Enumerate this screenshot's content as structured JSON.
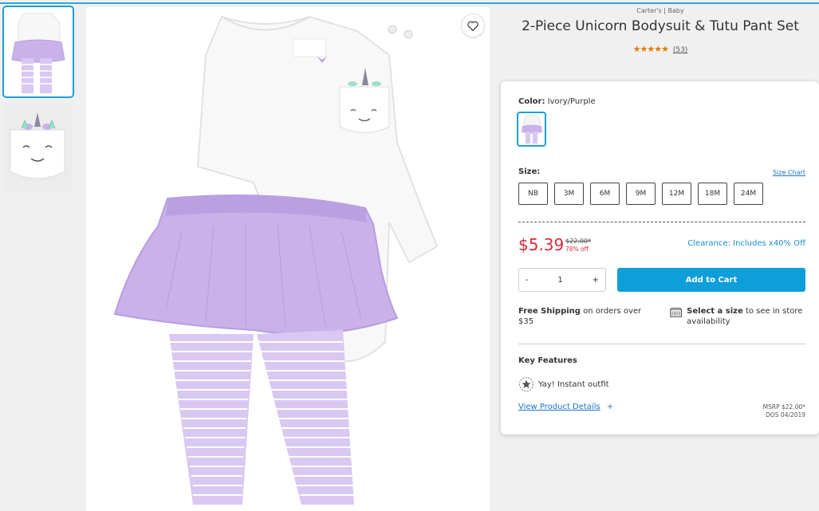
{
  "brand": "Carter's | Baby",
  "product_title": "2-Piece Unicorn Bodysuit & Tutu Pant Set",
  "rating": {
    "stars": "★★★★★",
    "reviews": "(53)"
  },
  "color": {
    "label": "Color:",
    "value": "Ivory/Purple"
  },
  "size": {
    "label": "Size:",
    "chart_link": "Size Chart",
    "options": [
      "NB",
      "3M",
      "6M",
      "9M",
      "12M",
      "18M",
      "24M"
    ]
  },
  "price": {
    "current": "$5.39",
    "original": "$22.00*",
    "percent_off": "78% off",
    "clearance": "Clearance: Includes x40% Off"
  },
  "quantity": {
    "minus": "-",
    "value": "1",
    "plus": "+"
  },
  "add_to_cart": "Add to Cart",
  "shipping": {
    "bold": "Free Shipping",
    "rest": " on orders over $35"
  },
  "store": {
    "bold": "Select a size",
    "rest": " to see in store availability"
  },
  "key_features": {
    "title": "Key Features",
    "items": [
      "Yay! Instant outfit"
    ]
  },
  "details_link": "View Product Details",
  "details_plus": "+",
  "msrp": {
    "line1": "MSRP $22.00*",
    "line2": "DOS 04/2019"
  },
  "colors": {
    "accent": "#0e9ed9",
    "sale_red": "#d42b3a",
    "lavender": "#c9b2ea",
    "star": "#e07a00"
  }
}
